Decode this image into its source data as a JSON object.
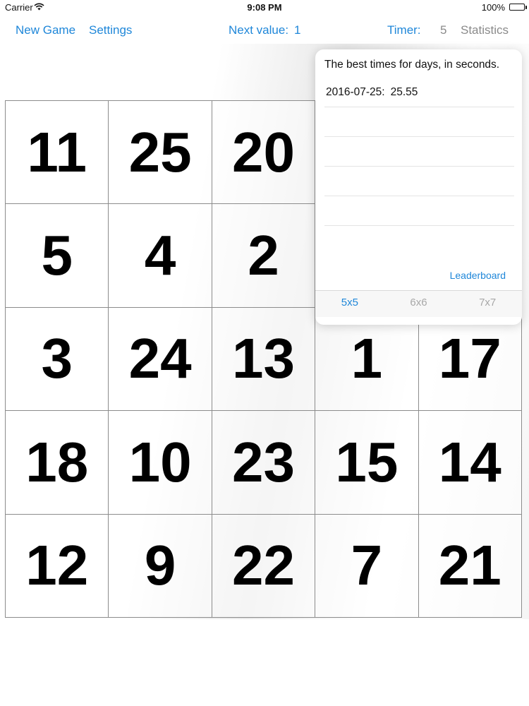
{
  "status_bar": {
    "carrier": "Carrier",
    "time": "9:08 PM",
    "battery": "100%"
  },
  "toolbar": {
    "new_game": "New Game",
    "settings": "Settings",
    "next_value_label": "Next value:",
    "next_value": "1",
    "timer_label": "Timer:",
    "timer_value": "5",
    "statistics": "Statistics"
  },
  "grid": {
    "rows": [
      [
        "11",
        "25",
        "20",
        "",
        ""
      ],
      [
        "5",
        "4",
        "2",
        "",
        ""
      ],
      [
        "3",
        "24",
        "13",
        "1",
        "17"
      ],
      [
        "18",
        "10",
        "23",
        "15",
        "14"
      ],
      [
        "12",
        "9",
        "22",
        "7",
        "21"
      ]
    ]
  },
  "popover": {
    "title": "The best times for days, in seconds.",
    "records": [
      {
        "date": "2016-07-25:",
        "time": "25.55"
      },
      {
        "date": "",
        "time": ""
      },
      {
        "date": "",
        "time": ""
      },
      {
        "date": "",
        "time": ""
      },
      {
        "date": "",
        "time": ""
      }
    ],
    "leaderboard": "Leaderboard",
    "segments": [
      {
        "label": "5x5",
        "active": true
      },
      {
        "label": "6x6",
        "active": false
      },
      {
        "label": "7x7",
        "active": false
      }
    ]
  },
  "colors": {
    "accent": "#1f87d9",
    "inactive": "#a8a8a8"
  }
}
